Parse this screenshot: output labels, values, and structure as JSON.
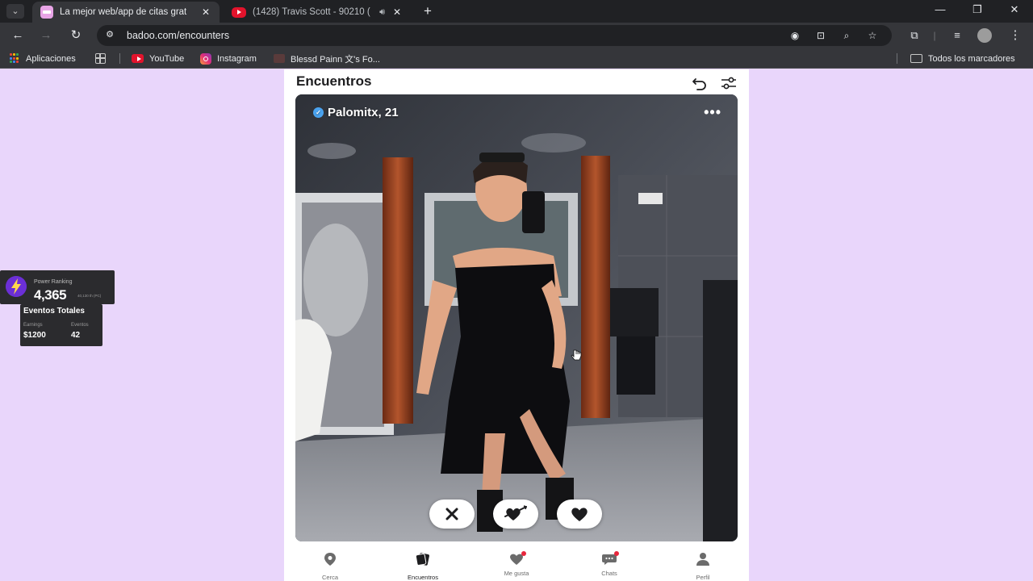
{
  "browser": {
    "tabs": [
      {
        "title": "La mejor web/app de citas grat",
        "active": true
      },
      {
        "title": "(1428) Travis Scott - 90210 (",
        "active": false
      }
    ],
    "url": "badoo.com/encounters",
    "bookmarks": [
      "Aplicaciones",
      "YouTube",
      "Instagram",
      "Blessd Painn 文's Fo..."
    ],
    "all_bookmarks": "Todos los marcadores"
  },
  "page": {
    "title": "Encuentros",
    "profile": {
      "name": "Palomitx, 21",
      "verified": true
    },
    "nav": [
      {
        "label": "Cerca",
        "icon": "location-pin-icon"
      },
      {
        "label": "Encuentros",
        "icon": "cards-icon",
        "active": true
      },
      {
        "label": "Me gusta",
        "icon": "likes-icon",
        "badge": true
      },
      {
        "label": "Chats",
        "icon": "chat-icon",
        "badge": true
      },
      {
        "label": "Perfil",
        "icon": "user-icon"
      }
    ],
    "accent": "#7000e3"
  },
  "overlay": {
    "power_label": "Power Ranking",
    "power_value": "4,365",
    "power_sub": "40,130 th (PC)",
    "events_title": "Eventos Totales",
    "earnings_label": "Earnings",
    "earnings_value": "$1200",
    "events_label": "Eventos",
    "events_value": "42"
  }
}
